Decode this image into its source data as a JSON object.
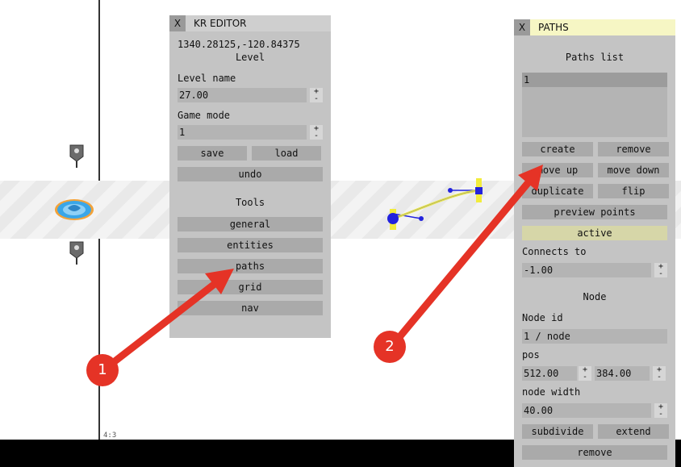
{
  "canvas": {
    "aspect_label": "4:3"
  },
  "kr_editor": {
    "close": "X",
    "title": "KR EDITOR",
    "coords": "1340.28125,-120.84375",
    "section_level": "Level",
    "level_name_label": "Level name",
    "level_name_value": "27.00",
    "game_mode_label": "Game mode",
    "game_mode_value": "1",
    "plus": "+",
    "minus": "-",
    "save": "save",
    "load": "load",
    "undo": "undo",
    "tools_label": "Tools",
    "tools": [
      "general",
      "entities",
      "paths",
      "grid",
      "nav"
    ]
  },
  "paths_panel": {
    "close": "X",
    "title": "PATHS",
    "list_title": "Paths list",
    "list_items": [
      "1"
    ],
    "create": "create",
    "remove": "remove",
    "move_up": "move up",
    "move_down": "move down",
    "duplicate": "duplicate",
    "flip": "flip",
    "preview_points": "preview points",
    "active": "active",
    "connects_to_label": "Connects to",
    "connects_to_value": "-1.00",
    "node_section": "Node",
    "node_id_label": "Node id",
    "node_id_value": "1 / node",
    "pos_label": "pos",
    "pos_x": "512.00",
    "pos_y": "384.00",
    "node_width_label": "node width",
    "node_width_value": "40.00",
    "subdivide": "subdivide",
    "extend": "extend",
    "remove_node": "remove"
  },
  "annotations": [
    "1",
    "2"
  ],
  "colors": {
    "arrow": "#e53326",
    "active": "#d6d6a8",
    "paths_title_bg": "#f6f6c4",
    "path_curve": "#e8e54a",
    "node": "#2222dd"
  }
}
